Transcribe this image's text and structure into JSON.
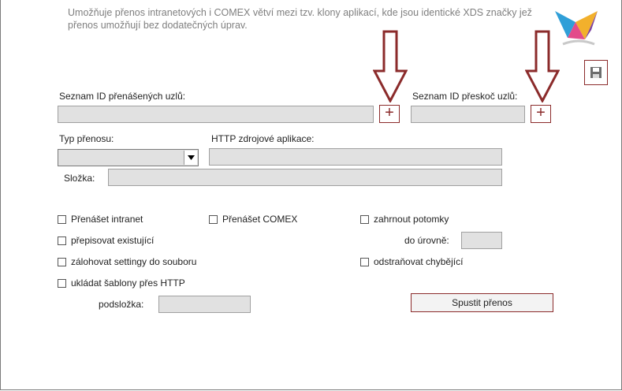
{
  "description": "Umožňuje přenos intranetových i COMEX větví mezi tzv. klony aplikací, kde jsou identické XDS značky jež přenos umožňují bez dodatečných úprav.",
  "nodes_label": "Seznam ID přenášených uzlů:",
  "skip_label": "Seznam ID přeskoč uzlů:",
  "plus_symbol": "+",
  "transfer_type_label": "Typ přenosu:",
  "http_source_label": "HTTP zdrojové aplikace:",
  "folder_label": "Složka:",
  "options": {
    "transfer_intranet": "Přenášet intranet",
    "transfer_comex": "Přenášet COMEX",
    "include_descendants": "zahrnout potomky",
    "overwrite_existing": "přepisovat existující",
    "to_level": "do úrovně:",
    "backup_settings": "zálohovat settingy do souboru",
    "remove_missing": "odstraňovat chybějící",
    "save_templates_http": "ukládat šablony přes HTTP",
    "subfolder": "podsložka:"
  },
  "run_button": "Spustit přenos",
  "icons": {
    "logo": "brand-logo-icon",
    "save": "floppy-disk-icon",
    "arrow": "down-arrow-annotation-icon",
    "dropdown": "chevron-down-icon"
  },
  "colors": {
    "accent": "#8b2b2b",
    "field_bg": "#e1e1e1",
    "muted_text": "#7f7f7f"
  }
}
